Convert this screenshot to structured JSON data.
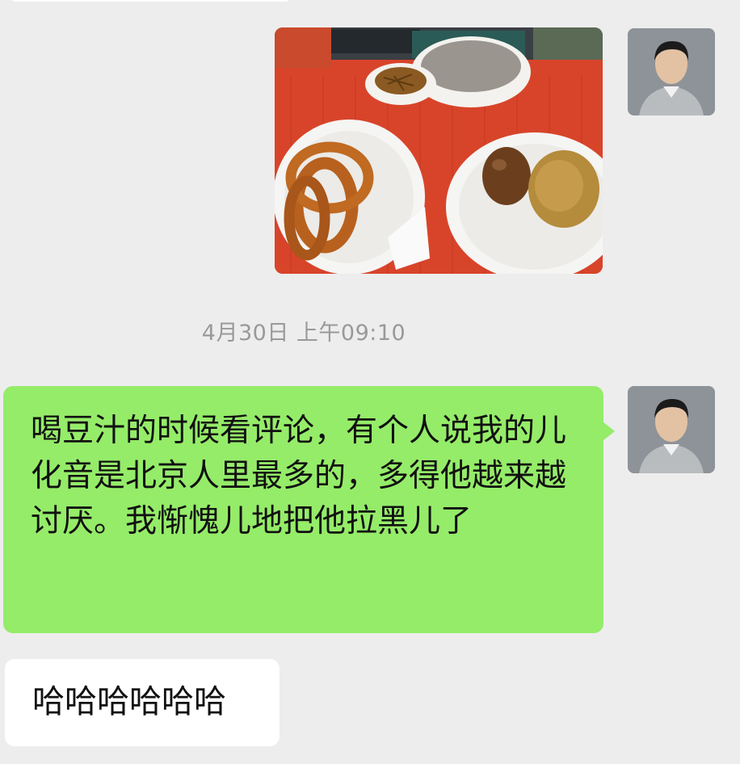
{
  "messages": [
    {
      "direction": "outgoing",
      "type": "image",
      "image_description": "food-tray-photo",
      "sender_avatar": "person-avatar"
    },
    {
      "type": "timestamp",
      "text": "4月30日 上午09:10"
    },
    {
      "direction": "outgoing",
      "type": "text",
      "text": "喝豆汁的时候看评论，有个人说我的儿化音是北京人里最多的，多得他越来越讨厌。我惭愧儿地把他拉黑儿了",
      "sender_avatar": "person-avatar"
    },
    {
      "direction": "incoming",
      "type": "text",
      "text": "哈哈哈哈哈哈"
    }
  ],
  "colors": {
    "background": "#ededed",
    "outgoing_bubble": "#95ec69",
    "incoming_bubble": "#ffffff",
    "timestamp": "#999999"
  }
}
